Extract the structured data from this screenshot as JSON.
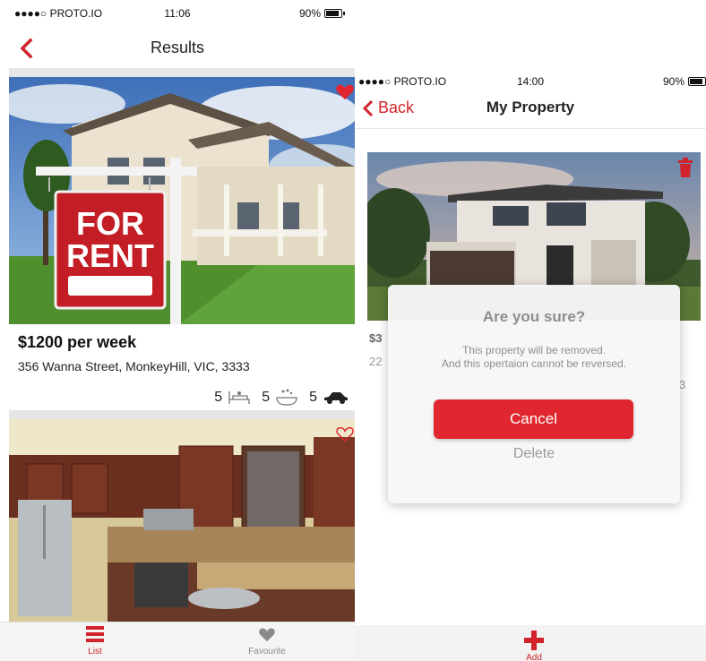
{
  "left_screen": {
    "status_bar": {
      "carrier": "●●●●○ PROTO.IO",
      "time": "11:06",
      "battery": "90%"
    },
    "nav": {
      "title": "Results",
      "back_icon": "chevron-left-icon"
    },
    "listings": [
      {
        "image": "for-rent-house-photo",
        "favourite": true,
        "price": "$1200 per week",
        "address": "356 Wanna Street, MonkeyHill, VIC, 3333",
        "bedrooms": "5",
        "bathrooms": "5",
        "parking": "5"
      },
      {
        "image": "kitchen-photo",
        "favourite": false
      }
    ],
    "tabs": [
      {
        "label": "List",
        "icon": "list-icon",
        "active": true
      },
      {
        "label": "Favourite",
        "icon": "heart-icon",
        "active": false
      }
    ]
  },
  "right_screen": {
    "status_bar": {
      "carrier": "●●●●○ PROTO.IO",
      "time": "14:00",
      "battery": "90%"
    },
    "nav": {
      "back_label": "Back",
      "title": "My Property"
    },
    "behind_card": {
      "price_partial": "$3",
      "address_partial": "22",
      "feature_partial": "3"
    },
    "dialog": {
      "title": "Are you sure?",
      "message_line1": "This property will be removed.",
      "message_line2": "And this opertaion cannot be reversed.",
      "cancel_label": "Cancel",
      "delete_label": "Delete"
    },
    "tab": {
      "label": "Add",
      "icon": "plus-icon"
    }
  },
  "colors": {
    "accent_red": "#d0232b",
    "modal_bg": "#f7f7f7",
    "muted_text": "#8e8e8e"
  }
}
